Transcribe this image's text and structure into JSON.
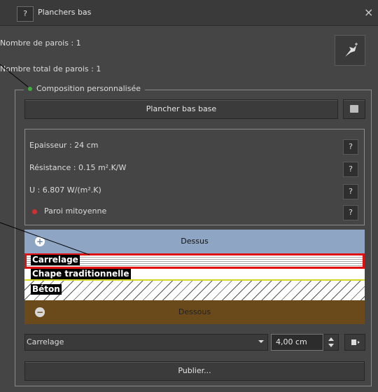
{
  "window": {
    "title": "Planchers bas",
    "help_label": "?",
    "close_label": "×"
  },
  "info": {
    "nombre_parois": "Nombre de parois : 1",
    "nombre_total": "Nombre total de parois : 1"
  },
  "composition": {
    "legend": "Composition personnalisée",
    "preset_button": "Plancher bas base",
    "properties": {
      "epaisseur": "Epaisseur : 24 cm",
      "resistance": "Résistance : 0.15 m².K/W",
      "u": "U : 6.807 W/(m².K)",
      "mitoyenne": "Paroi mitoyenne",
      "help_label": "?"
    },
    "layers": {
      "top_label": "Dessus",
      "bottom_label": "Dessous",
      "items": [
        {
          "name": "Carrelage",
          "selected": true
        },
        {
          "name": "Chape traditionnelle",
          "selected": false
        },
        {
          "name": "Béton",
          "selected": false
        }
      ]
    },
    "material_select": {
      "value": "Carrelage"
    },
    "thickness": {
      "value": "4,00 cm"
    },
    "publish_button": "Publier..."
  },
  "colors": {
    "panel": "#454545",
    "dessus": "#8ea5c4",
    "dessous": "#6a4a1a",
    "selection": "#e01010",
    "green_dot": "#3fae3f",
    "red_dot": "#d03030"
  }
}
